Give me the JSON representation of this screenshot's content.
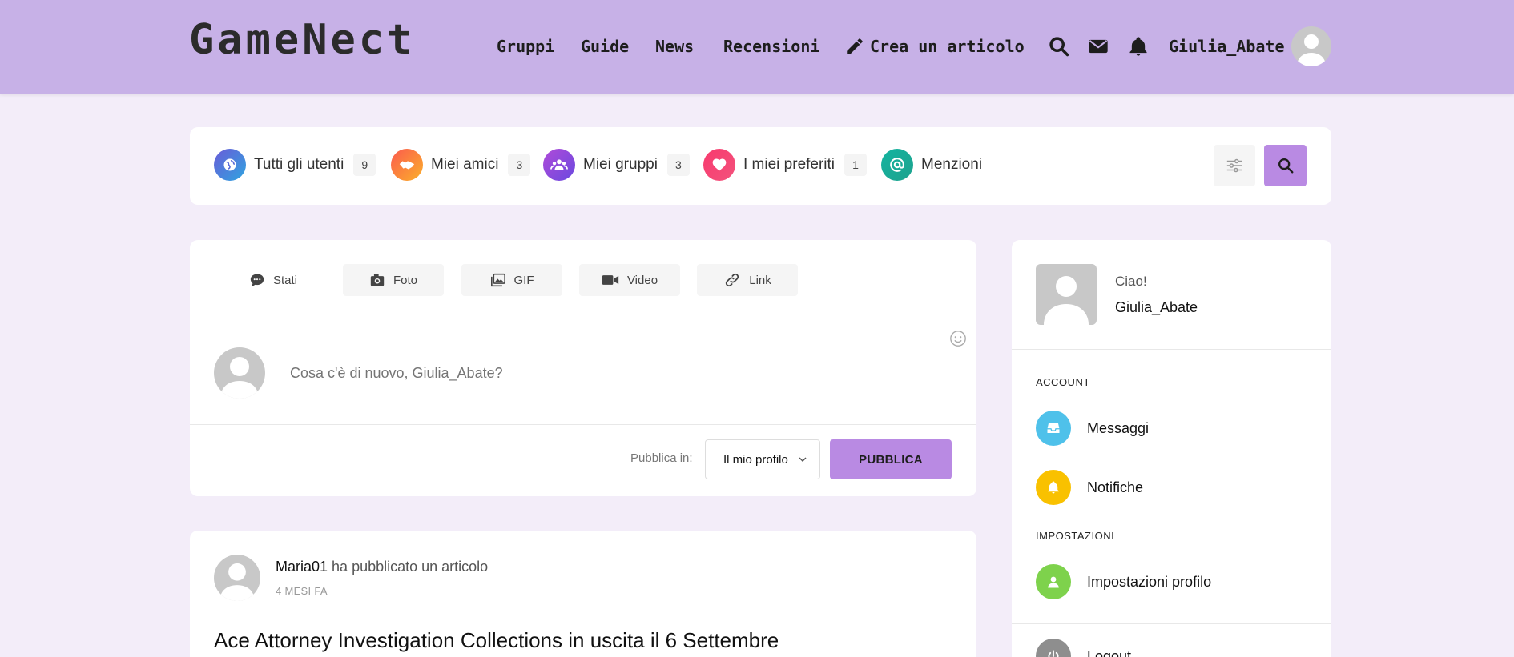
{
  "header": {
    "logo": "GameNect",
    "nav": [
      "Gruppi",
      "Guide",
      "News",
      "Recensioni"
    ],
    "create_article": "Crea un articolo",
    "username": "Giulia_Abate"
  },
  "filters": {
    "items": [
      {
        "label": "Tutti gli utenti",
        "count": "9",
        "icon": "globe-icon",
        "color": "#4a6fd6"
      },
      {
        "label": "Miei amici",
        "count": "3",
        "icon": "handshake-icon",
        "color": "#f7763a"
      },
      {
        "label": "Miei gruppi",
        "count": "3",
        "icon": "users-icon",
        "color": "#8a4fdc"
      },
      {
        "label": "I miei preferiti",
        "count": "1",
        "icon": "heart-icon",
        "color": "#f23a73"
      },
      {
        "label": "Menzioni",
        "count": "",
        "icon": "at-icon",
        "color": "#1bb29b"
      }
    ]
  },
  "composer": {
    "tabs": [
      "Stati",
      "Foto",
      "GIF",
      "Video",
      "Link"
    ],
    "placeholder": "Cosa c'è di nuovo, Giulia_Abate?",
    "publish_in_label": "Pubblica in:",
    "publish_in_value": "Il mio profilo",
    "publish_button": "PUBBLICA"
  },
  "post": {
    "author": "Maria01",
    "action": "ha pubblicato un articolo",
    "time": "4 MESI FA",
    "title": "Ace Attorney Investigation Collections in uscita il 6 Settembre"
  },
  "sidebar": {
    "greeting": "Ciao!",
    "username": "Giulia_Abate",
    "account_title": "ACCOUNT",
    "account_items": [
      {
        "label": "Messaggi",
        "icon": "inbox-icon",
        "color": "#4fc1ea"
      },
      {
        "label": "Notifiche",
        "icon": "bell-icon",
        "color": "#f9c100"
      }
    ],
    "settings_title": "IMPOSTAZIONI",
    "settings_items": [
      {
        "label": "Impostazioni profilo",
        "icon": "user-icon",
        "color": "#7ed24c"
      }
    ],
    "logout": "Logout"
  },
  "colors": {
    "header_bg": "#c7b1e7",
    "page_bg": "#f3edf9",
    "accent": "#b98ae3"
  }
}
